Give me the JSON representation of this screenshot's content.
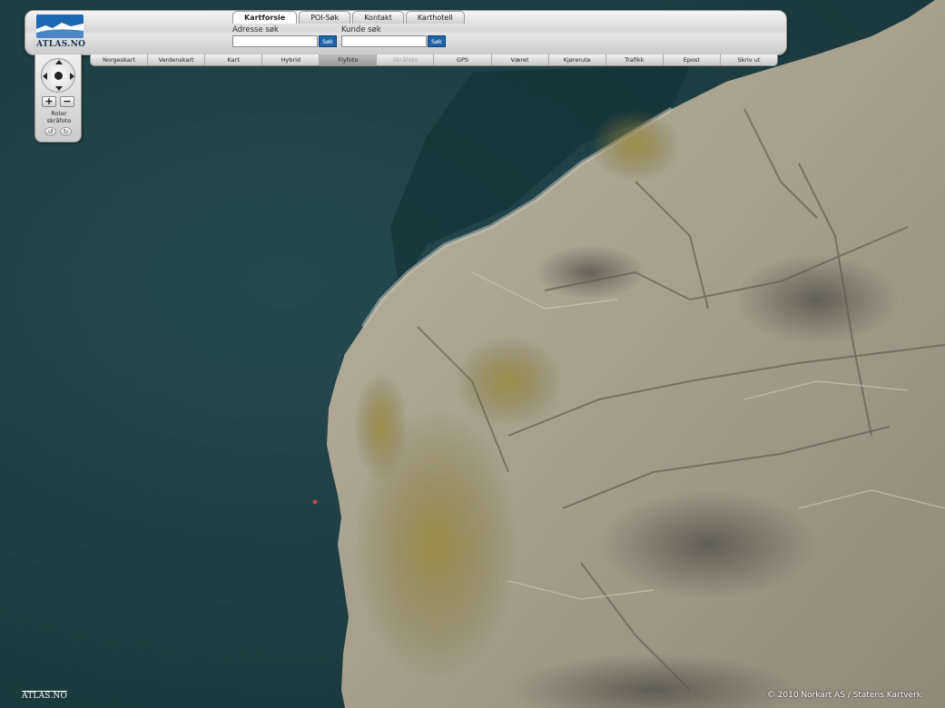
{
  "header": {
    "logo_text": "ATLAS.NO",
    "tabs": [
      {
        "label": "Kartforsie",
        "active": true
      },
      {
        "label": "POI-Søk",
        "active": false
      },
      {
        "label": "Kontakt",
        "active": false
      },
      {
        "label": "Karthotell",
        "active": false
      }
    ],
    "address_search": {
      "label": "Adresse søk",
      "value": "",
      "button": "Søk"
    },
    "customer_search": {
      "label": "Kunde søk",
      "value": "",
      "button": "Søk"
    }
  },
  "toolbar": {
    "buttons": [
      {
        "label": "Norgeskart",
        "state": "normal"
      },
      {
        "label": "Verdenskart",
        "state": "normal"
      },
      {
        "label": "Kart",
        "state": "normal"
      },
      {
        "label": "Hybrid",
        "state": "normal"
      },
      {
        "label": "Flyfoto",
        "state": "active"
      },
      {
        "label": "Skråfoto",
        "state": "disabled"
      },
      {
        "label": "GPS",
        "state": "normal"
      },
      {
        "label": "Været",
        "state": "normal"
      },
      {
        "label": "Kjørerute",
        "state": "normal"
      },
      {
        "label": "Trafikk",
        "state": "normal"
      },
      {
        "label": "Epost",
        "state": "normal"
      },
      {
        "label": "Skriv ut",
        "state": "normal"
      }
    ]
  },
  "nav": {
    "zoom_in": "+",
    "zoom_out": "−",
    "rotate_label_1": "Roter",
    "rotate_label_2": "skråfoto",
    "rotate_left": "↺",
    "rotate_right": "↻"
  },
  "footer": {
    "logo_text": "ATLAS.NO",
    "copyright": "© 2010 Norkart AS / Statens Kartverk"
  },
  "colors": {
    "water": "#1f4146",
    "rock": "#a9a38e",
    "vegetation": "#8c7a3a",
    "accent_button": "#1e64a6"
  }
}
